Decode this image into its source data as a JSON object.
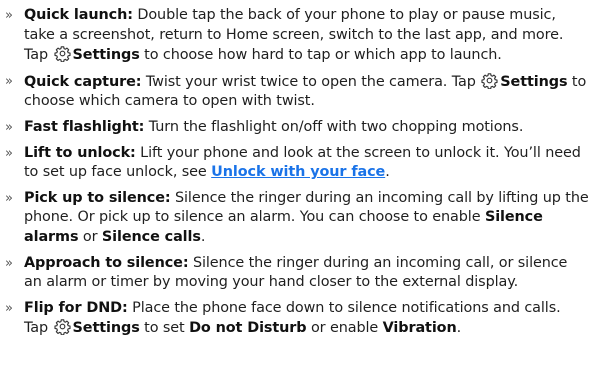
{
  "items": [
    {
      "title": "Quick launch:",
      "text1": " Double tap the back of your phone to play or pause music, take a screenshot, return to Home screen, switch to the last app, and more. Tap ",
      "settings": "Settings",
      "text2": " to choose how hard to tap or which app to launch."
    },
    {
      "title": "Quick capture:",
      "text1": " Twist your wrist twice to open the camera. Tap ",
      "settings": "Settings",
      "text2": " to choose which camera to open with twist."
    },
    {
      "title": "Fast flashlight:",
      "text1": " Turn the flashlight on/off with two chopping motions."
    },
    {
      "title": "Lift to unlock:",
      "text1": " Lift your phone and look at the screen to unlock it. You’ll need to set up face unlock, see ",
      "link": "Unlock with your face",
      "text2": "."
    },
    {
      "title": "Pick up to silence:",
      "text1": " Silence the ringer during an incoming call by lifting up the phone. Or pick up to silence an alarm. You can choose to enable ",
      "bold1": "Silence alarms",
      "text2": " or ",
      "bold2": "Silence calls",
      "text3": "."
    },
    {
      "title": "Approach to silence:",
      "text1": " Silence the ringer during an incoming call, or silence an alarm or timer by moving your hand closer to the external display."
    },
    {
      "title": "Flip for DND:",
      "text1": " Place the phone face down to silence notifications and calls. Tap ",
      "settings": "Settings",
      "text2": " to set ",
      "bold1": "Do not Disturb",
      "text3": " or enable ",
      "bold2": "Vibration",
      "text4": "."
    }
  ],
  "bullet": "»",
  "colors": {
    "link": "#1a73e8",
    "text": "#1f1f1f"
  },
  "icons": {
    "settings": "gear-icon"
  }
}
